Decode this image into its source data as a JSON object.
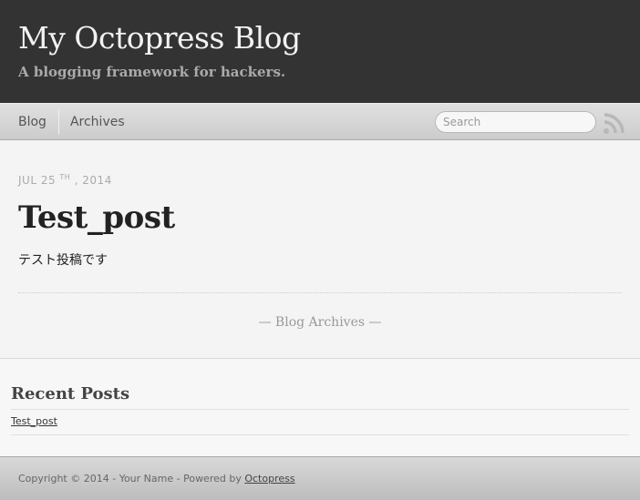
{
  "header": {
    "title": "My Octopress Blog",
    "subtitle": "A blogging framework for hackers."
  },
  "nav": {
    "items": [
      {
        "label": "Blog"
      },
      {
        "label": "Archives"
      }
    ],
    "search_placeholder": "Search",
    "rss_icon": "rss-icon"
  },
  "post": {
    "date_month_day": "Jul 25",
    "date_suffix": "th",
    "date_year": ", 2014",
    "title": "Test_post",
    "body": "テスト投稿です",
    "archive_link": "— Blog Archives —"
  },
  "sidebar": {
    "heading": "Recent Posts",
    "posts": [
      {
        "label": "Test_post"
      }
    ]
  },
  "footer": {
    "text": "Copyright © 2014 - Your Name - Powered by ",
    "link": "Octopress"
  },
  "colors": {
    "header_bg": "#333333",
    "title": "#f2f2f2",
    "subtitle": "#aaaaaa",
    "nav_bg": "#d4d4d4",
    "content_bg": "#f4f4f4"
  }
}
